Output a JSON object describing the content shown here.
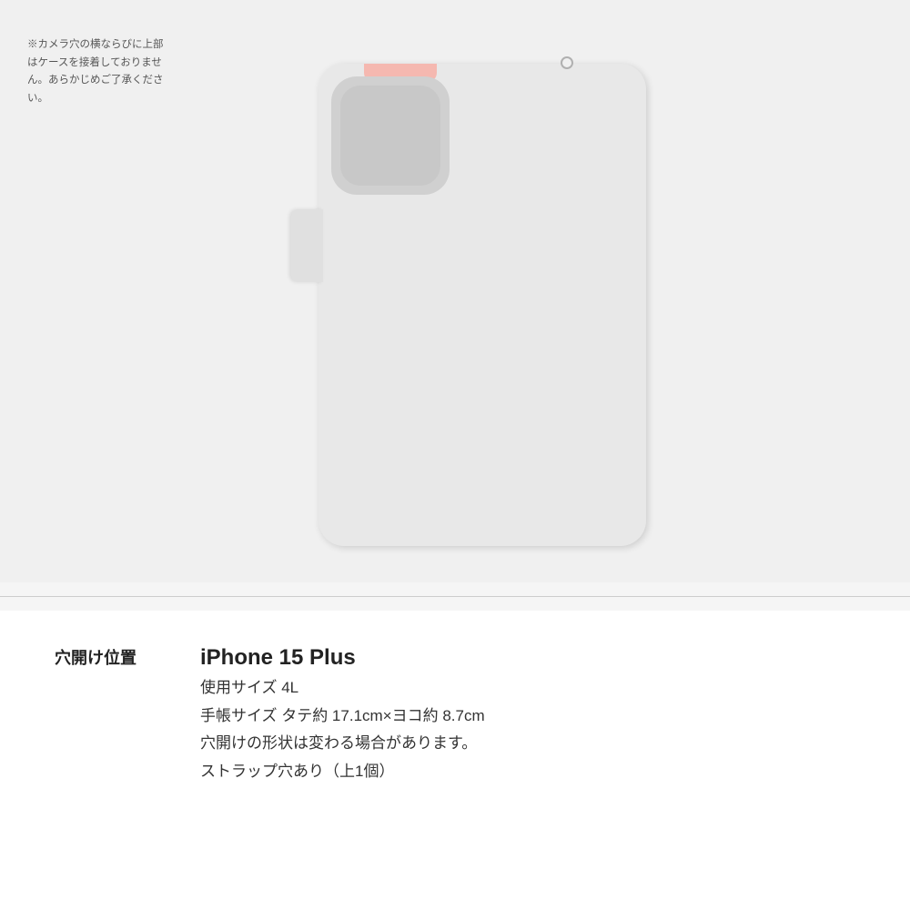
{
  "case_illustration": {
    "camera_note": "※カメラ穴の横ならびに上部はケースを接着しておりません。あらかじめご了承ください。"
  },
  "info_section": {
    "label": "穴開け位置",
    "device_name": "iPhone 15 Plus",
    "size_label": "使用サイズ 4L",
    "dimensions": "手帳サイズ タテ約 17.1cm×ヨコ約 8.7cm",
    "shape_note": "穴開けの形状は変わる場合があります。",
    "strap_note": "ストラップ穴あり（上1個）"
  }
}
